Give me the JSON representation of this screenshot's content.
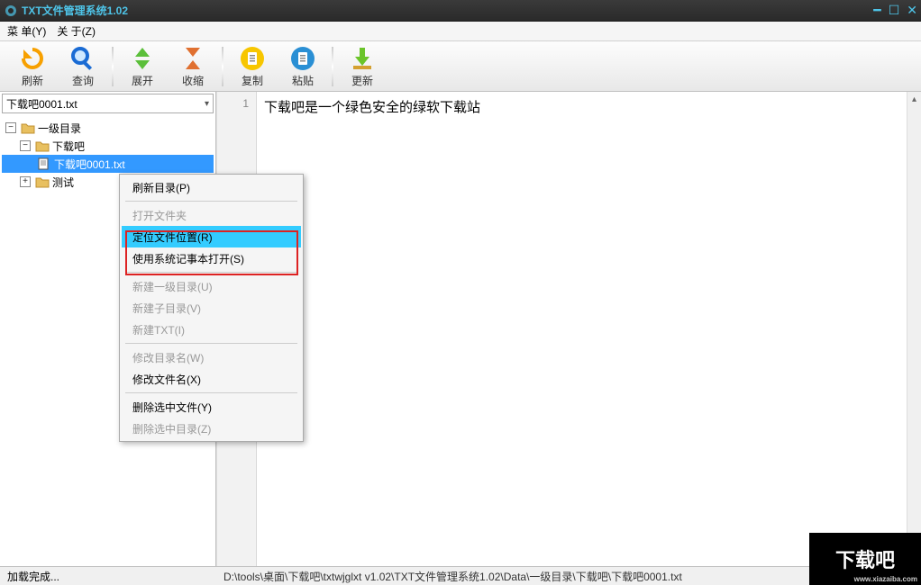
{
  "window": {
    "title": "TXT文件管理系统1.02"
  },
  "menubar": {
    "menu": "菜 单(Y)",
    "about": "关 于(Z)"
  },
  "toolbar": {
    "refresh": "刷新",
    "search": "查询",
    "expand": "展开",
    "collapse": "收缩",
    "copy": "复制",
    "paste": "粘贴",
    "update": "更新"
  },
  "combo": {
    "value": "下载吧0001.txt"
  },
  "tree": {
    "n0": "一级目录",
    "n1": "下载吧",
    "n2": "下载吧0001.txt",
    "n3": "测试"
  },
  "editor": {
    "line1_no": "1",
    "line1_text": "下载吧是一个绿色安全的绿软下载站"
  },
  "context": {
    "refresh_dir": "刷新目录(P)",
    "open_folder": "打开文件夹",
    "locate_file": "定位文件位置(R)",
    "open_notepad": "使用系统记事本打开(S)",
    "new_root": "新建一级目录(U)",
    "new_sub": "新建子目录(V)",
    "new_txt": "新建TXT(I)",
    "rename_dir": "修改目录名(W)",
    "rename_file": "修改文件名(X)",
    "del_file": "删除选中文件(Y)",
    "del_dir": "删除选中目录(Z)"
  },
  "status": {
    "left": "加载完成...",
    "right": "D:\\tools\\桌面\\下载吧\\txtwjglxt v1.02\\TXT文件管理系统1.02\\Data\\一级目录\\下载吧\\下载吧0001.txt"
  },
  "watermark": {
    "text": "下载吧",
    "sub": "www.xiazaiba.com"
  }
}
